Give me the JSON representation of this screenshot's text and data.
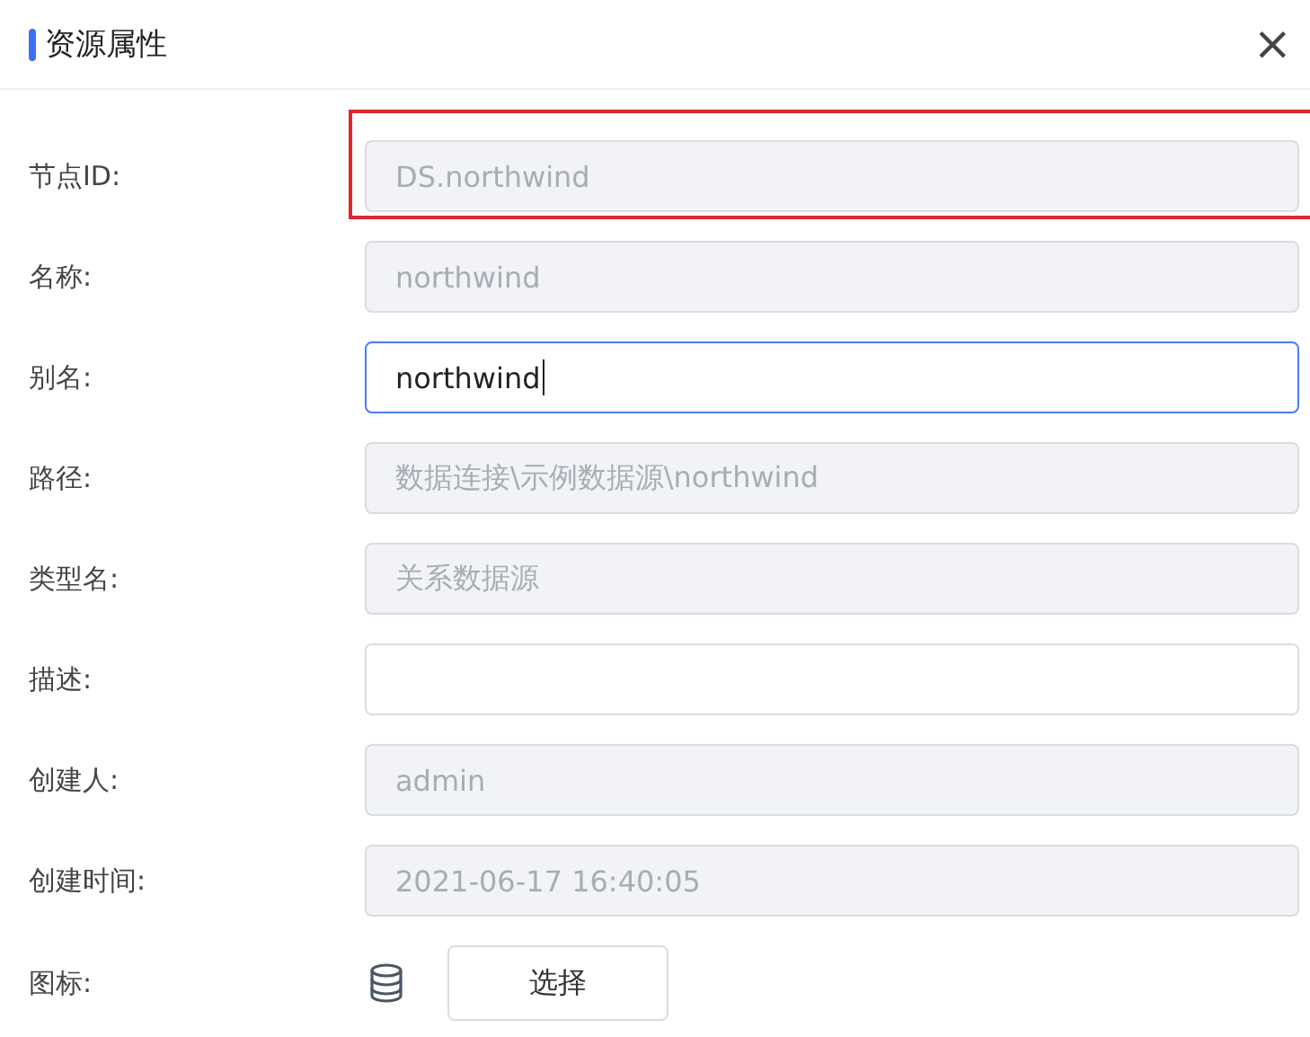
{
  "dialog": {
    "title": "资源属性",
    "close": "×"
  },
  "fields": [
    {
      "kind": "text",
      "label": "节点ID:",
      "value": "DS.northwind",
      "disabled": true,
      "focused": false,
      "highlighted": true
    },
    {
      "kind": "text",
      "label": "名称:",
      "value": "northwind",
      "disabled": true,
      "focused": false,
      "highlighted": false
    },
    {
      "kind": "text",
      "label": "别名:",
      "value": "northwind",
      "disabled": false,
      "focused": true,
      "highlighted": false
    },
    {
      "kind": "text",
      "label": "路径:",
      "value": "数据连接\\示例数据源\\northwind",
      "disabled": true,
      "focused": false,
      "highlighted": false
    },
    {
      "kind": "text",
      "label": "类型名:",
      "value": "关系数据源",
      "disabled": true,
      "focused": false,
      "highlighted": false
    },
    {
      "kind": "text",
      "label": "描述:",
      "disabled": false,
      "focused": false,
      "highlighted": false
    },
    {
      "kind": "text",
      "label": "创建人:",
      "value": "admin",
      "disabled": true,
      "focused": false,
      "highlighted": false
    },
    {
      "kind": "text",
      "label": "创建时间:",
      "value": "2021-06-17 16:40:05",
      "disabled": true,
      "focused": false,
      "highlighted": false
    },
    {
      "kind": "icon",
      "label": "图标:",
      "button": "选择"
    }
  ]
}
